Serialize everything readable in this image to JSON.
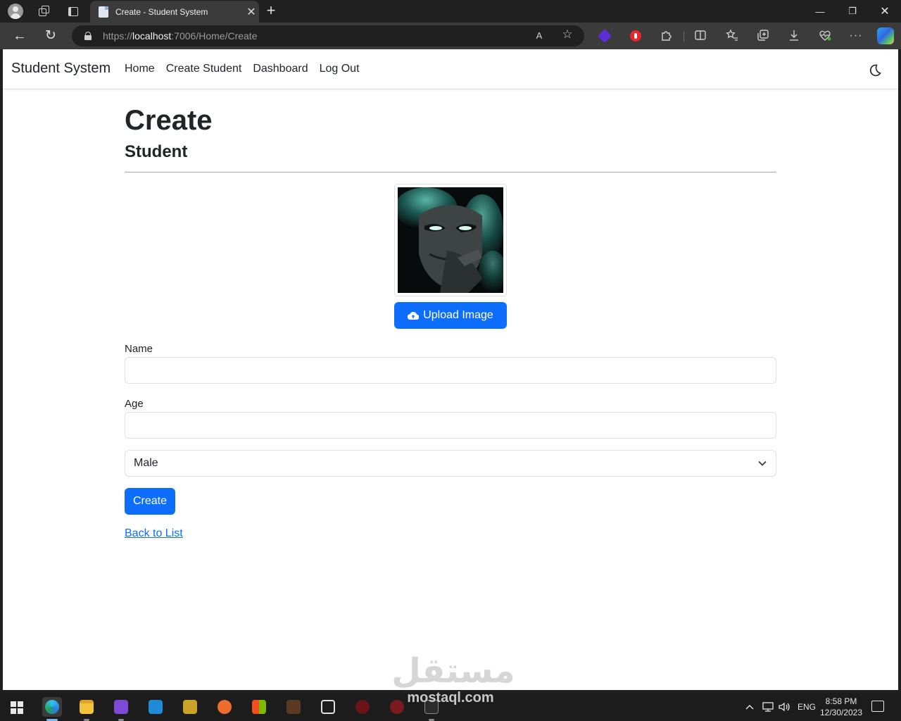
{
  "browser": {
    "tab_title": "Create - Student System",
    "url_scheme": "https://",
    "url_host": "localhost",
    "url_rest": ":7006/Home/Create",
    "close_glyph": "✕",
    "new_tab_glyph": "+",
    "minimize_glyph": "—",
    "restore_glyph": "❐",
    "window_close_glyph": "✕",
    "back_glyph": "←",
    "reload_glyph": "↻",
    "read_aloud_glyph": "A",
    "favorite_glyph": "☆",
    "more_glyph": "···"
  },
  "navbar": {
    "brand": "Student System",
    "links": [
      "Home",
      "Create Student",
      "Dashboard",
      "Log Out"
    ]
  },
  "page": {
    "title": "Create",
    "subtitle": "Student",
    "upload_label": "Upload Image",
    "form": {
      "name_label": "Name",
      "name_value": "",
      "age_label": "Age",
      "age_value": "",
      "gender_selected": "Male",
      "submit_label": "Create"
    },
    "back_link": "Back to List"
  },
  "watermark": {
    "arabic": "مستقل",
    "latin": "mostaql.com"
  },
  "taskbar": {
    "lang": "ENG",
    "time": "8:58 PM",
    "date": "12/30/2023"
  },
  "colors": {
    "primary": "#0d6efd",
    "text": "#212529",
    "border": "#dee2e6"
  }
}
